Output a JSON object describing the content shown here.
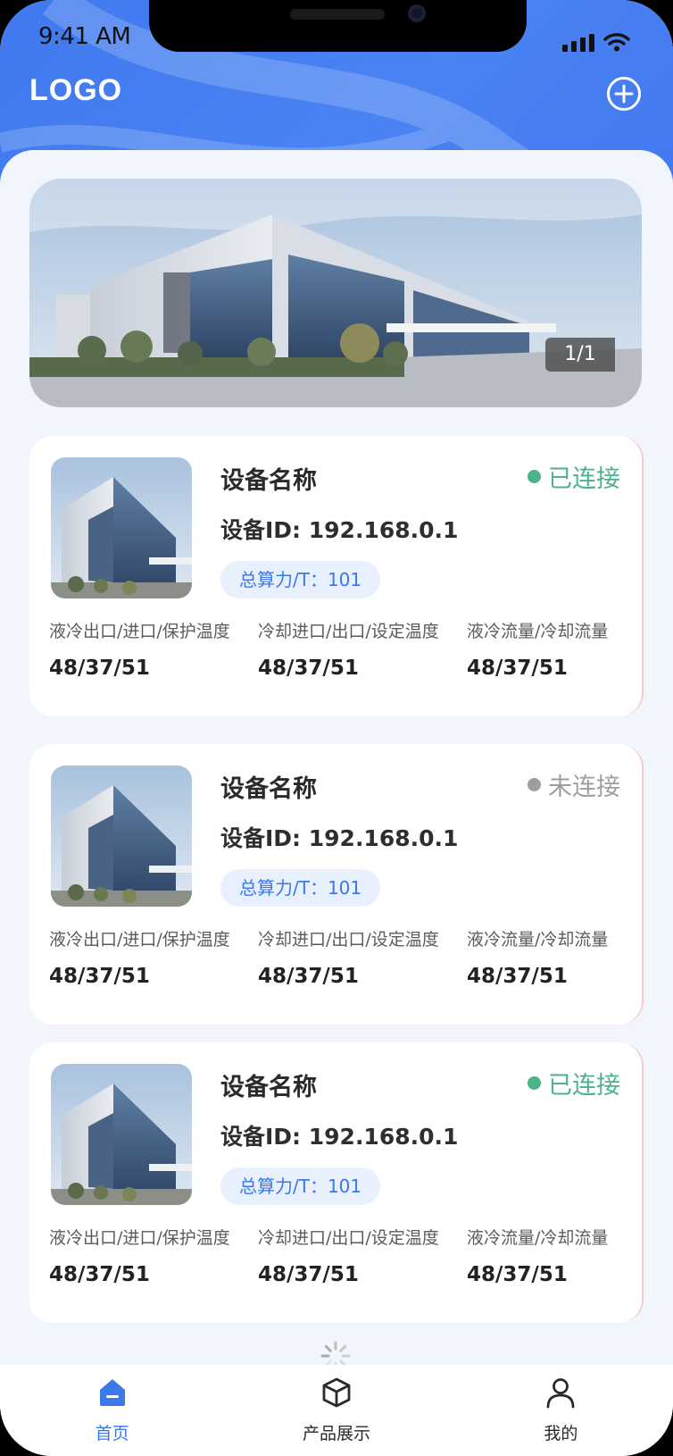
{
  "status_bar": {
    "time": "9:41 AM"
  },
  "header": {
    "logo": "LOGO"
  },
  "banner": {
    "pager": "1/1"
  },
  "devices": [
    {
      "name": "设备名称",
      "status": "已连接",
      "status_color": "#4bb38a",
      "id": "设备ID: 192.168.0.1",
      "power": "总算力/T：101",
      "metrics": [
        {
          "label": "液冷出口/进口/保护温度",
          "value": "48/37/51"
        },
        {
          "label": "冷却进口/出口/设定温度",
          "value": "48/37/51"
        },
        {
          "label": "液冷流量/冷却流量",
          "value": "48/37/51"
        }
      ]
    },
    {
      "name": "设备名称",
      "status": "未连接",
      "status_color": "#9e9e9e",
      "id": "设备ID: 192.168.0.1",
      "power": "总算力/T：101",
      "metrics": [
        {
          "label": "液冷出口/进口/保护温度",
          "value": "48/37/51"
        },
        {
          "label": "冷却进口/出口/设定温度",
          "value": "48/37/51"
        },
        {
          "label": "液冷流量/冷却流量",
          "value": "48/37/51"
        }
      ]
    },
    {
      "name": "设备名称",
      "status": "已连接",
      "status_color": "#4bb38a",
      "id": "设备ID: 192.168.0.1",
      "power": "总算力/T：101",
      "metrics": [
        {
          "label": "液冷出口/进口/保护温度",
          "value": "48/37/51"
        },
        {
          "label": "冷却进口/出口/设定温度",
          "value": "48/37/51"
        },
        {
          "label": "液冷流量/冷却流量",
          "value": "48/37/51"
        }
      ]
    }
  ],
  "tabbar": {
    "items": [
      {
        "label": "首页",
        "icon": "home-icon",
        "active": true
      },
      {
        "label": "产品展示",
        "icon": "box-icon",
        "active": false
      },
      {
        "label": "我的",
        "icon": "user-icon",
        "active": false
      }
    ]
  },
  "colors": {
    "accent": "#3b78e8",
    "header": "#4a83f3",
    "connected": "#4bb38a",
    "disconnected": "#9e9e9e"
  }
}
